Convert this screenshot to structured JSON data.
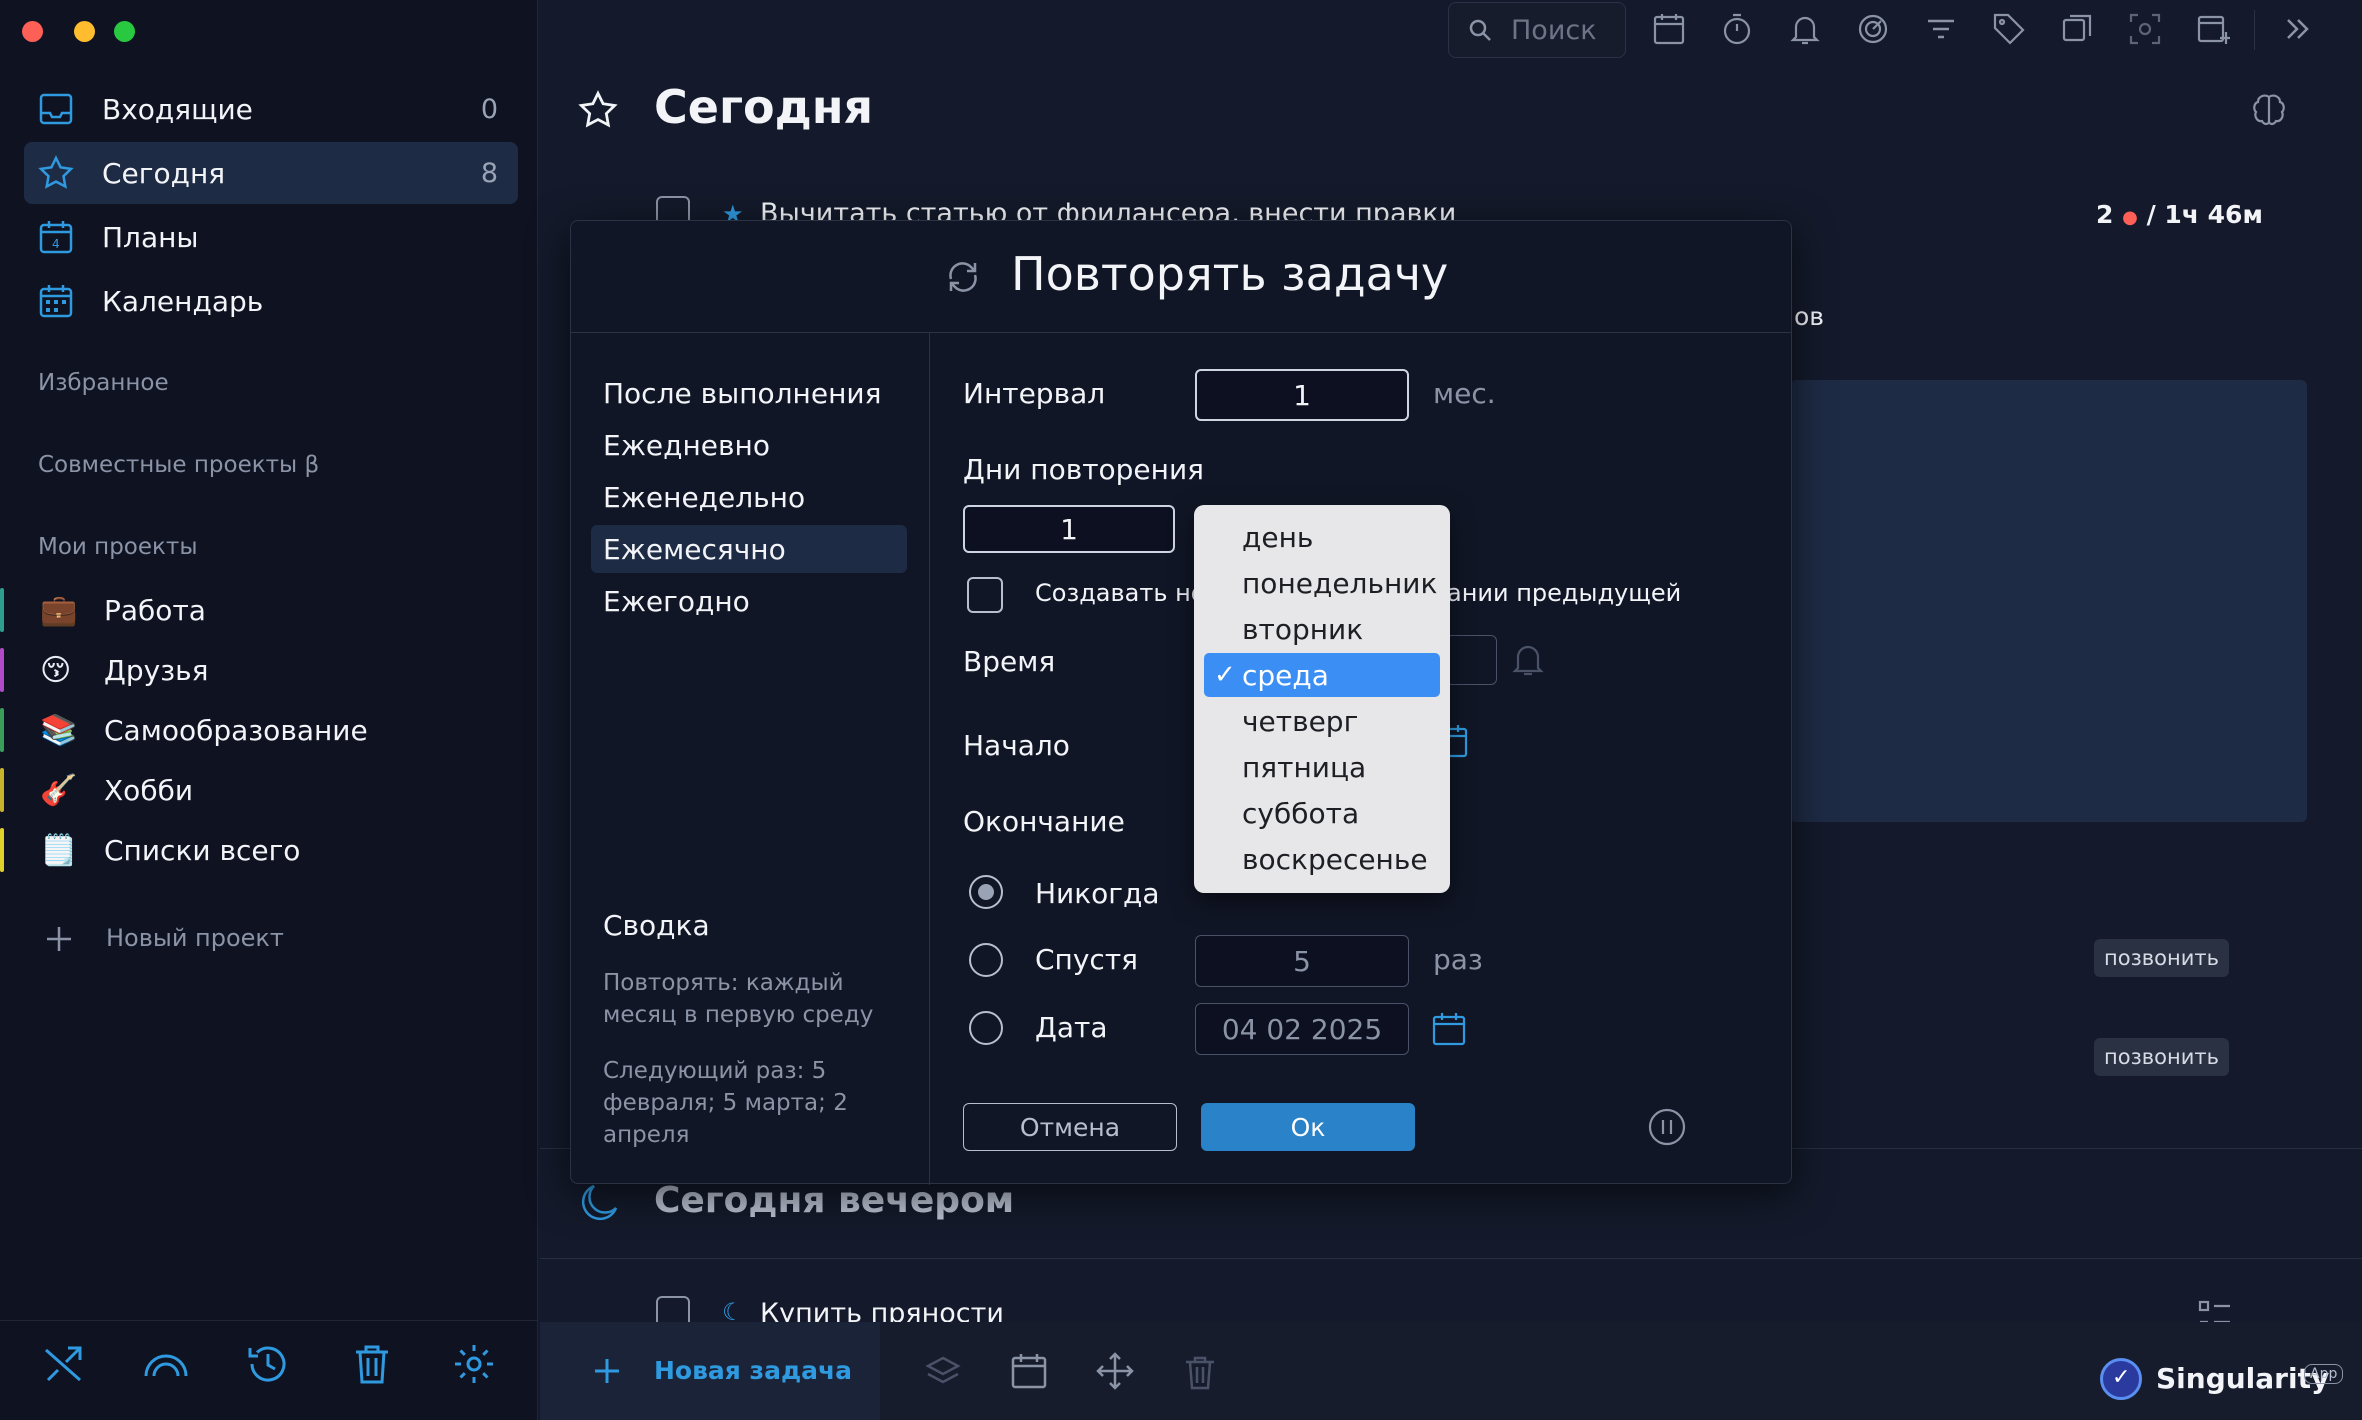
{
  "sidebar": {
    "nav": [
      {
        "label": "Входящие",
        "count": "0",
        "icon": "inbox-icon"
      },
      {
        "label": "Сегодня",
        "count": "8",
        "icon": "star-icon"
      },
      {
        "label": "Планы",
        "count": "",
        "icon": "calendar-plans-icon"
      },
      {
        "label": "Календарь",
        "count": "",
        "icon": "calendar-grid-icon"
      }
    ],
    "favorites_label": "Избранное",
    "shared_label": "Совместные проекты β",
    "my_projects_label": "Мои проекты",
    "projects": [
      {
        "label": "Работа",
        "emoji": "💼",
        "color": "#2e9e8e"
      },
      {
        "label": "Друзья",
        "emoji": "😚",
        "color": "#b04ac8"
      },
      {
        "label": "Самообразование",
        "emoji": "📚",
        "color": "#3a9e5a"
      },
      {
        "label": "Хобби",
        "emoji": "🎸",
        "color": "#c8b42a"
      },
      {
        "label": "Списки всего",
        "emoji": "🗒️",
        "color": "#e0d02a"
      }
    ],
    "new_project_label": "Новый проект"
  },
  "header": {
    "search_placeholder": "Поиск",
    "title": "Сегодня"
  },
  "tasks": {
    "task1": "Вычитать статью от фрилансера, внести правки",
    "task1_meta_count": "2",
    "task1_meta_time": "/ 1ч 46м",
    "partial_text": "ов",
    "pill1": "позвонить",
    "pill2": "позвонить",
    "evening_title": "Сегодня вечером",
    "task2": "Купить пряности"
  },
  "footer": {
    "new_task_label": "Новая задача",
    "brand": "Singularity",
    "brand_badge": "App"
  },
  "dialog": {
    "title": "Повторять задачу",
    "modes": [
      "После выполнения",
      "Ежедневно",
      "Еженедельно",
      "Ежемесячно",
      "Ежегодно"
    ],
    "active_mode": 3,
    "interval_label": "Интервал",
    "interval_value": "1",
    "interval_unit": "мес.",
    "days_label": "Дни повторения",
    "days_value": "1",
    "create_new_label_start": "Создавать но",
    "create_new_label_end": "ании предыдущей",
    "time_label": "Время",
    "start_label": "Начало",
    "end_label": "Окончание",
    "end_never": "Никогда",
    "end_after": "Спустя",
    "end_after_value": "5",
    "end_after_unit": "раз",
    "end_date": "Дата",
    "end_date_value": "04 02 2025",
    "summary_title": "Сводка",
    "summary_text": "Повторять: каждый месяц в первую среду",
    "next_text": "Следующий раз: 5 февраля; 5 марта; 2 апреля",
    "cancel_label": "Отмена",
    "ok_label": "Ок"
  },
  "dropdown": {
    "options": [
      "день",
      "понедельник",
      "вторник",
      "среда",
      "четверг",
      "пятница",
      "суббота",
      "воскресенье"
    ],
    "selected": 3
  },
  "colors": {
    "accent": "#2f9ae0",
    "selected": "#3b8ff4",
    "ok_button": "#2a82c9"
  }
}
